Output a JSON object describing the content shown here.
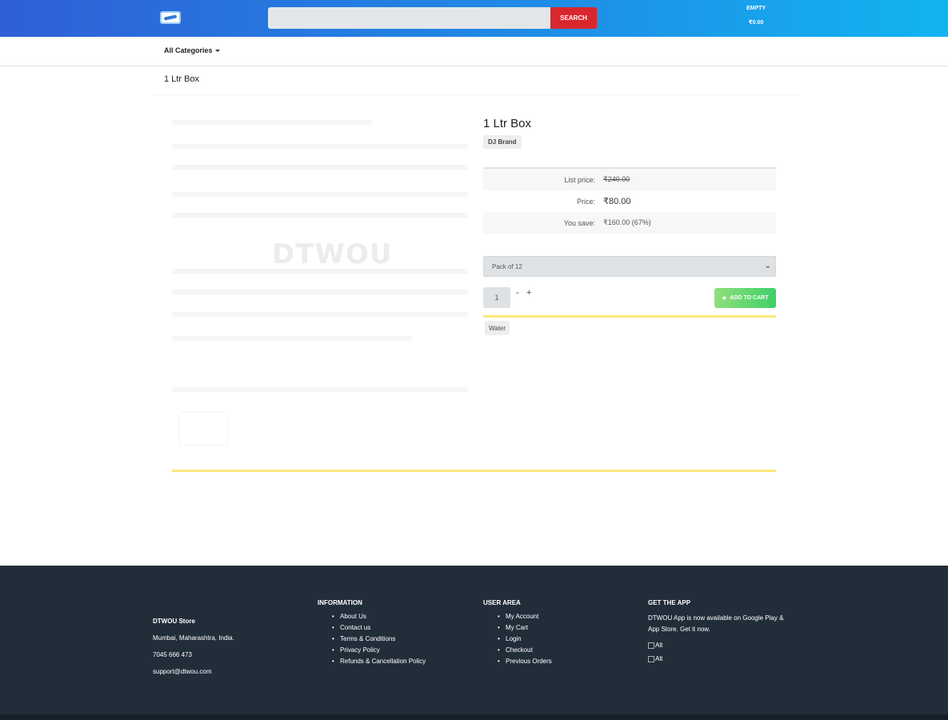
{
  "header": {
    "search_placeholder": "",
    "search_button": "SEARCH",
    "cart_label": "EMPTY",
    "cart_total": "₹0.00"
  },
  "nav": {
    "categories_label": "All Categories"
  },
  "breadcrumb": "1 Ltr Box",
  "product": {
    "watermark": "DTWOU",
    "title": "1 Ltr Box",
    "brand": "DJ Brand",
    "list_price_label": "List price:",
    "list_price": "₹240.00",
    "price_label": "Price:",
    "price": "₹80.00",
    "save_label": "You save:",
    "save_value": "₹160.00 (67%)",
    "variant_selected": "Pack of 12",
    "qty": "1",
    "qty_minus": "-",
    "qty_plus": "+",
    "add_to_cart": "ADD TO CART",
    "tag": "Water"
  },
  "footer": {
    "store": {
      "name": "DTWOU Store",
      "address": "Mumbai, Maharashtra, India.",
      "phone": "7045 666 473",
      "email": "support@dtwou.com"
    },
    "information": {
      "heading": "INFORMATION",
      "links": [
        "About Us",
        "Contact us",
        "Terms & Conditions",
        "Privacy Policy",
        "Refunds & Cancellation Policy"
      ]
    },
    "user_area": {
      "heading": "USER AREA",
      "links": [
        "My Account",
        "My Cart",
        "Login",
        "Checkout",
        "Previous Orders"
      ]
    },
    "app": {
      "heading": "GET THE APP",
      "text": "DTWOU App is now available on Google Play & App Store. Get it now.",
      "img_alt_1": "Alt",
      "img_alt_2": "Alt"
    }
  },
  "colors": {
    "header_start": "#2f5fd6",
    "header_end": "#12b4f0",
    "search_button": "#d9272e",
    "add_to_cart": "#3fcf6a",
    "footer_bg": "#222d3a",
    "accent_line": "#fbe77a"
  }
}
